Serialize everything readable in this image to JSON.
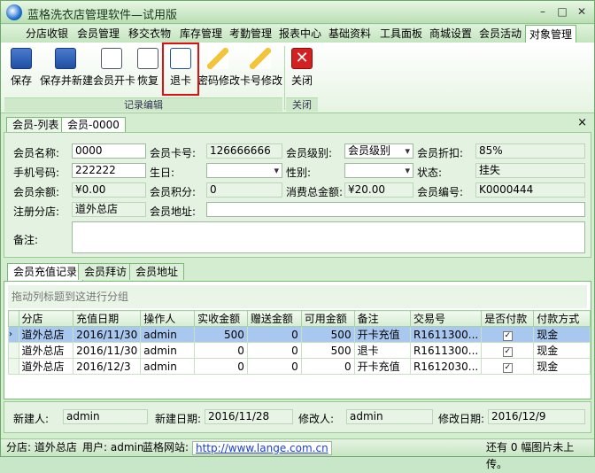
{
  "window": {
    "title": "蓝格洗衣店管理软件—试用版",
    "min": "–",
    "restore": "□",
    "close": "✕"
  },
  "menu": [
    "分店收银",
    "会员管理",
    "移交衣物",
    "库存管理",
    "考勤管理",
    "报表中心",
    "基础资料",
    "工具面板",
    "商城设置",
    "会员活动",
    "对象管理"
  ],
  "ribbon": {
    "buttons": [
      "保存",
      "保存并新建",
      "会员开卡",
      "恢复",
      "退卡",
      "密码修改",
      "卡号修改",
      "关闭"
    ],
    "groups": [
      "记录编辑",
      "关闭"
    ]
  },
  "doc_tabs": [
    "会员-列表",
    "会员-0000"
  ],
  "doc_close": "×",
  "form": {
    "member_name_label": "会员名称:",
    "member_name": "0000",
    "card_no_label": "会员卡号:",
    "card_no": "126666666",
    "level_label": "会员级别:",
    "level": "会员级别",
    "discount_label": "会员折扣:",
    "discount": "85%",
    "phone_label": "手机号码:",
    "phone": "222222",
    "birthday_label": "生日:",
    "birthday": "",
    "gender_label": "性别:",
    "gender": "",
    "status_label": "状态:",
    "status": "挂失",
    "balance_label": "会员余额:",
    "balance": "¥0.00",
    "points_label": "会员积分:",
    "points": "0",
    "total_spend_label": "消费总金额:",
    "total_spend": "¥20.00",
    "member_id_label": "会员编号:",
    "member_id": "K0000444",
    "branch_label": "注册分店:",
    "branch": "道外总店",
    "address_label": "会员地址:",
    "address": "",
    "remark_label": "备注:",
    "remark": ""
  },
  "sub_tabs": [
    "会员充值记录",
    "会员拜访",
    "会员地址"
  ],
  "grid": {
    "group_hint": "拖动列标题到这进行分组",
    "columns": [
      "分店",
      "充值日期",
      "操作人",
      "实收金额",
      "赠送金额",
      "可用金额",
      "备注",
      "交易号",
      "是否付款",
      "付款方式"
    ],
    "rows": [
      [
        "道外总店",
        "2016/11/30",
        "admin",
        "500",
        "0",
        "500",
        "开卡充值",
        "R1611300...",
        "✓",
        "现金"
      ],
      [
        "道外总店",
        "2016/11/30",
        "admin",
        "0",
        "0",
        "500",
        "退卡",
        "R1611300...",
        "✓",
        "现金"
      ],
      [
        "道外总店",
        "2016/12/3",
        "admin",
        "0",
        "0",
        "0",
        "开卡充值",
        "R1612030...",
        "✓",
        "现金"
      ]
    ],
    "row_indicator": "›"
  },
  "footer": {
    "creator_label": "新建人:",
    "creator": "admin",
    "created_label": "新建日期:",
    "created": "2016/11/28",
    "modifier_label": "修改人:",
    "modifier": "admin",
    "modified_label": "修改日期:",
    "modified": "2016/12/9"
  },
  "status": {
    "branch": "分店: 道外总店",
    "user": "用户: admin",
    "site_label": "蓝格网站:",
    "site": "http://www.lange.com.cn",
    "unread": "还有 0 幅图片未上传。"
  },
  "colors": {
    "accent_red": "#e01010",
    "selection": "#a9c8f0",
    "window_green": "#d4ecd0"
  }
}
